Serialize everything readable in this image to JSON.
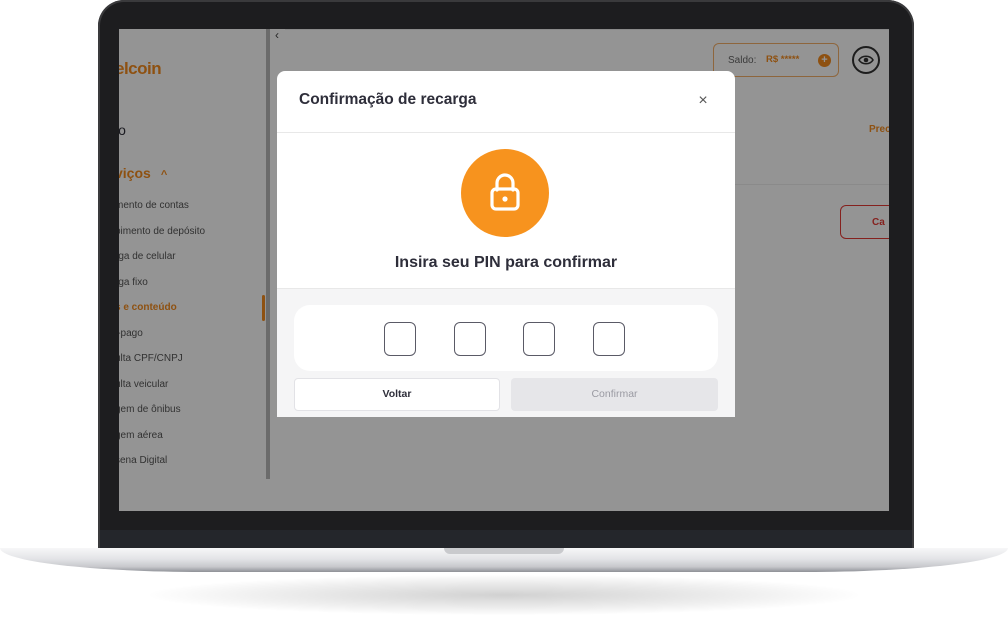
{
  "app": {
    "logo_text": "elcoin",
    "collapse_icon": "chevron-left-icon"
  },
  "sidebar": {
    "inicio_label": "io",
    "servicos_label": "viços",
    "servicos_chevron": "^",
    "items": [
      {
        "label": "mento de contas",
        "active": false
      },
      {
        "label": "pimento de depósito",
        "active": false
      },
      {
        "label": "rga de celular",
        "active": false
      },
      {
        "label": "rga fixo",
        "active": false
      },
      {
        "label": "s e conteúdo",
        "active": true
      },
      {
        "label": "i-pago",
        "active": false
      },
      {
        "label": "ulta CPF/CNPJ",
        "active": false
      },
      {
        "label": "ulta veicular",
        "active": false
      },
      {
        "label": "gem de ônibus",
        "active": false
      },
      {
        "label": "gem aérea",
        "active": false
      },
      {
        "label": "sena Digital",
        "active": false
      }
    ]
  },
  "header": {
    "saldo_label": "Saldo:",
    "saldo_value": "R$ *****",
    "saldo_plus_icon": "plus-circle-icon",
    "eye_icon": "eye-icon"
  },
  "page": {
    "prec_text": "Prec",
    "cancel_text": "Ca"
  },
  "modal": {
    "title": "Confirmação de recarga",
    "close_glyph": "×",
    "lock_icon": "lock-icon",
    "pin_prompt": "Insira seu PIN para confirmar",
    "pin_digits": [
      "",
      "",
      "",
      ""
    ],
    "back_label": "Voltar",
    "confirm_label": "Confirmar"
  },
  "colors": {
    "brand_orange": "#f7931e",
    "danger_red": "#e53935",
    "text_dark": "#2e2e3a",
    "disabled_bg": "#e6e6e9"
  }
}
